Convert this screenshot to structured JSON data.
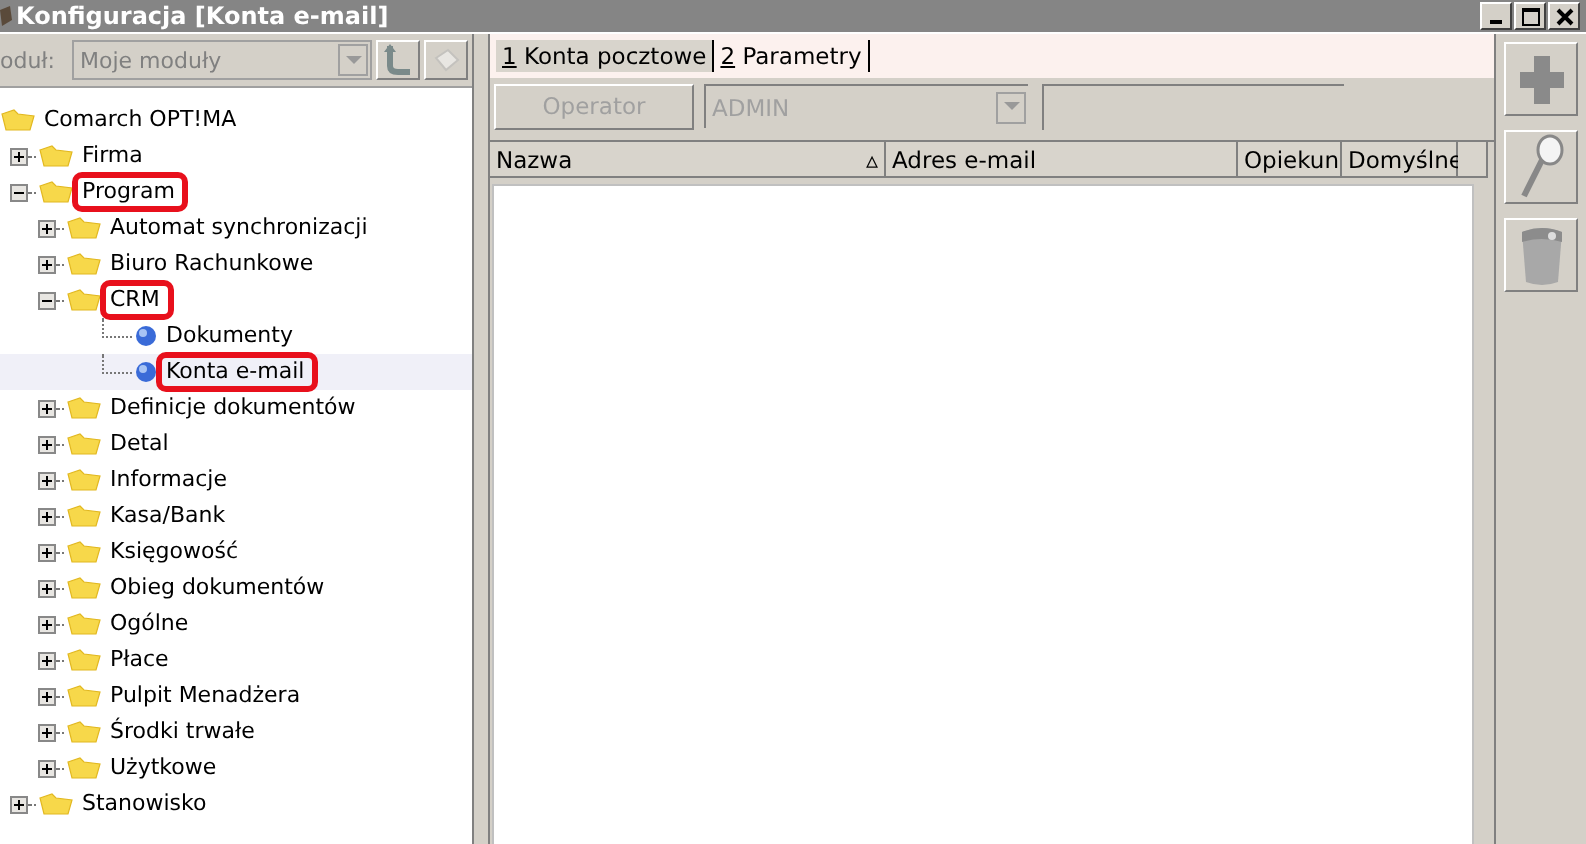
{
  "window": {
    "title": "Konfiguracja [Konta e-mail]"
  },
  "module": {
    "label": "oduł:",
    "value": "Moje moduły",
    "disabled": true
  },
  "tree": [
    {
      "label": "Comarch OPT!MA",
      "kind": "root",
      "selected": false,
      "highlighted": false,
      "children": [
        {
          "label": "Firma",
          "kind": "folder",
          "expanded": false,
          "selected": false,
          "highlighted": false
        },
        {
          "label": "Program",
          "kind": "folder",
          "expanded": true,
          "selected": false,
          "highlighted": true,
          "children": [
            {
              "label": "Automat synchronizacji",
              "kind": "folder",
              "expanded": false,
              "selected": false,
              "highlighted": false
            },
            {
              "label": "Biuro Rachunkowe",
              "kind": "folder",
              "expanded": false,
              "selected": false,
              "highlighted": false
            },
            {
              "label": "CRM",
              "kind": "folder",
              "expanded": true,
              "selected": false,
              "highlighted": true,
              "children": [
                {
                  "label": "Dokumenty",
                  "kind": "leaf",
                  "selected": false,
                  "highlighted": false
                },
                {
                  "label": "Konta e-mail",
                  "kind": "leaf",
                  "selected": true,
                  "highlighted": true
                }
              ]
            },
            {
              "label": "Definicje dokumentów",
              "kind": "folder",
              "expanded": false,
              "selected": false,
              "highlighted": false
            },
            {
              "label": "Detal",
              "kind": "folder",
              "expanded": false,
              "selected": false,
              "highlighted": false
            },
            {
              "label": "Informacje",
              "kind": "folder",
              "expanded": false,
              "selected": false,
              "highlighted": false
            },
            {
              "label": "Kasa/Bank",
              "kind": "folder",
              "expanded": false,
              "selected": false,
              "highlighted": false
            },
            {
              "label": "Księgowość",
              "kind": "folder",
              "expanded": false,
              "selected": false,
              "highlighted": false
            },
            {
              "label": "Obieg dokumentów",
              "kind": "folder",
              "expanded": false,
              "selected": false,
              "highlighted": false
            },
            {
              "label": "Ogólne",
              "kind": "folder",
              "expanded": false,
              "selected": false,
              "highlighted": false
            },
            {
              "label": "Płace",
              "kind": "folder",
              "expanded": false,
              "selected": false,
              "highlighted": false
            },
            {
              "label": "Pulpit Menadżera",
              "kind": "folder",
              "expanded": false,
              "selected": false,
              "highlighted": false
            },
            {
              "label": "Środki trwałe",
              "kind": "folder",
              "expanded": false,
              "selected": false,
              "highlighted": false
            },
            {
              "label": "Użytkowe",
              "kind": "folder",
              "expanded": false,
              "selected": false,
              "highlighted": false
            }
          ]
        },
        {
          "label": "Stanowisko",
          "kind": "folder",
          "expanded": false,
          "selected": false,
          "highlighted": false
        }
      ]
    }
  ],
  "tabs": [
    {
      "key": "1",
      "label": "Konta pocztowe",
      "selected": true
    },
    {
      "key": "2",
      "label": "Parametry",
      "selected": false
    }
  ],
  "filter": {
    "button": "Operator",
    "operator": "ADMIN",
    "disabled": true
  },
  "table": {
    "columns": [
      {
        "label": "Nazwa",
        "sort": "▵"
      },
      {
        "label": "Adres e-mail"
      },
      {
        "label": "Opiekun"
      },
      {
        "label": "Domyślne"
      }
    ]
  }
}
